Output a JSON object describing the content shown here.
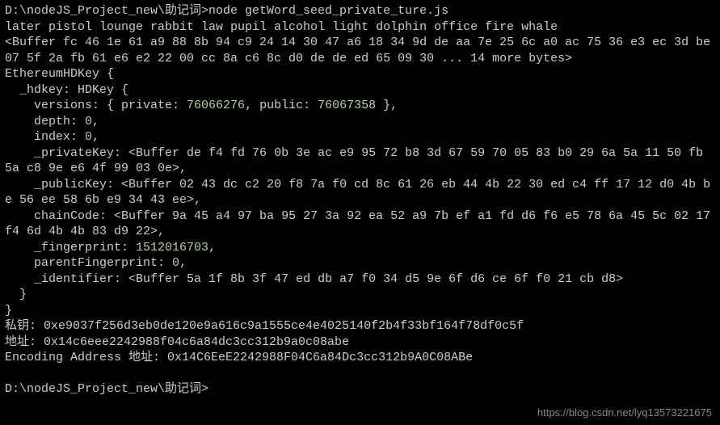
{
  "prompt1": "D:\\nodeJS_Project_new\\助记词>node getWord_seed_private_ture.js",
  "mnemonic": "later pistol lounge rabbit law pupil alcohol light dolphin office fire whale",
  "buffer1": "<Buffer fc 46 1e 61 a9 88 8b 94 c9 24 14 30 47 a6 18 34 9d de aa 7e 25 6c a0 ac 75 36 e3 ec 3d be 07 5f 2a fb 61 e6 e2 22 00 cc 8a c6 8c d0 de de ed 65 09 30 ... 14 more bytes>",
  "obj_name": "EthereumHDKey {",
  "hdkey_line": "  _hdkey: HDKey {",
  "versions_prefix": "    versions: { private: ",
  "versions_private": "76066276",
  "versions_mid": ", public: ",
  "versions_public": "76067358",
  "versions_suffix": " },",
  "depth_prefix": "    depth: ",
  "depth_val": "0",
  "depth_suffix": ",",
  "index_prefix": "    index: ",
  "index_val": "0",
  "index_suffix": ",",
  "privateKey": "    _privateKey: <Buffer de f4 fd 76 0b 3e ac e9 95 72 b8 3d 67 59 70 05 83 b0 29 6a 5a 11 50 fb 5a c8 9e e6 4f 99 03 0e>,",
  "publicKey": "    _publicKey: <Buffer 02 43 dc c2 20 f8 7a f0 cd 8c 61 26 eb 44 4b 22 30 ed c4 ff 17 12 d0 4b be 56 ee 58 6b e9 34 43 ee>,",
  "chainCode": "    chainCode: <Buffer 9a 45 a4 97 ba 95 27 3a 92 ea 52 a9 7b ef a1 fd d6 f6 e5 78 6a 45 5c 02 17 f4 6d 4b 4b 83 d9 22>,",
  "fingerprint_prefix": "    _fingerprint: ",
  "fingerprint_val": "1512016703",
  "fingerprint_suffix": ",",
  "parentFingerprint_prefix": "    parentFingerprint: ",
  "parentFingerprint_val": "0",
  "parentFingerprint_suffix": ",",
  "identifier": "    _identifier: <Buffer 5a 1f 8b 3f 47 ed db a7 f0 34 d5 9e 6f d6 ce 6f f0 21 cb d8>",
  "close1": "  }",
  "close2": "}",
  "privkey_line": "私钥: 0xe9037f256d3eb0de120e9a616c9a1555ce4e4025140f2b4f33bf164f78df0c5f",
  "address_line": "地址: 0x14c6eee2242988f04c6a84dc3cc312b9a0c08abe",
  "encoding_line": "Encoding Address 地址: 0x14C6EeE2242988F04C6a84Dc3cc312b9A0C08ABe",
  "prompt2": "D:\\nodeJS_Project_new\\助记词>",
  "watermark": "https://blog.csdn.net/lyq13573221675"
}
